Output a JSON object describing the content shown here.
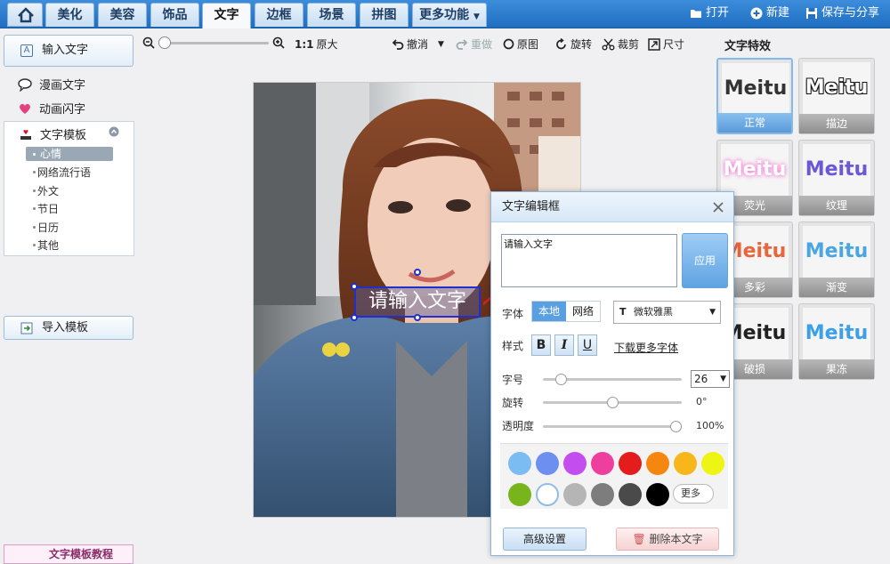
{
  "topbar": {
    "tabs": [
      "美化",
      "美容",
      "饰品",
      "文字",
      "边框",
      "场景",
      "拼图",
      "更多功能"
    ],
    "active_tab": "文字",
    "actions": {
      "open": "打开",
      "new": "新建",
      "save_share": "保存与分享"
    }
  },
  "sidebar": {
    "input_text": "输入文字",
    "comic_text": "漫画文字",
    "anim_text": "动画闪字",
    "template": {
      "title": "文字模板",
      "items": [
        "心情",
        "网络流行语",
        "外文",
        "节日",
        "日历",
        "其他"
      ],
      "selected": "心情"
    },
    "import_template": "导入模板",
    "tutorial": "文字模板教程"
  },
  "toolbar": {
    "zoom_ratio": "1:1",
    "original_size": "原大",
    "undo": "撤消",
    "redo": "重做",
    "original": "原图",
    "rotate": "旋转",
    "crop": "裁剪",
    "size": "尺寸"
  },
  "canvas": {
    "overlay_text": "请输入文字"
  },
  "effects": {
    "title": "文字特效",
    "items": [
      {
        "sample": "Meitu",
        "label": "正常",
        "color": "#333333"
      },
      {
        "sample": "Meitu",
        "label": "描边",
        "color": "#111111"
      },
      {
        "sample": "Meitu",
        "label": "荧光",
        "color": "#f3b8e6"
      },
      {
        "sample": "Meitu",
        "label": "纹理",
        "color": "#6a58d6"
      },
      {
        "sample": "Meitu",
        "label": "多彩",
        "color": "#e8663a"
      },
      {
        "sample": "Meitu",
        "label": "渐变",
        "color": "#4aa6e0"
      },
      {
        "sample": "Meitu",
        "label": "破损",
        "color": "#222222"
      },
      {
        "sample": "Meitu",
        "label": "果冻",
        "color": "#3ca0e8"
      }
    ],
    "selected": "正常"
  },
  "dialog": {
    "title": "文字编辑框",
    "text_value": "请输入文字",
    "apply": "应用",
    "font_label": "字体",
    "font_source": [
      "本地",
      "网络"
    ],
    "font_source_selected": "本地",
    "font_name": "微软雅黑",
    "style_label": "样式",
    "style_buttons": [
      "B",
      "I",
      "U"
    ],
    "download_fonts": "下载更多字体",
    "size_label": "字号",
    "size_value": "26",
    "size_fraction": 0.1,
    "rotate_label": "旋转",
    "rotate_value": "0°",
    "rotate_fraction": 0.5,
    "opacity_label": "透明度",
    "opacity_value": "100%",
    "opacity_fraction": 1.0,
    "colors_row1": [
      "#7bbcf3",
      "#6d8ff0",
      "#c44df0",
      "#ee3f9e",
      "#e41c1c",
      "#f5860f",
      "#f7b71a",
      "#eef514"
    ],
    "colors_row2": [
      "#78b41c",
      "#ffffff",
      "#b5b5b5",
      "#7d7d7d",
      "#4a4a4a",
      "#000000"
    ],
    "more_colors": "更多",
    "advanced": "高级设置",
    "delete": "删除本文字"
  }
}
